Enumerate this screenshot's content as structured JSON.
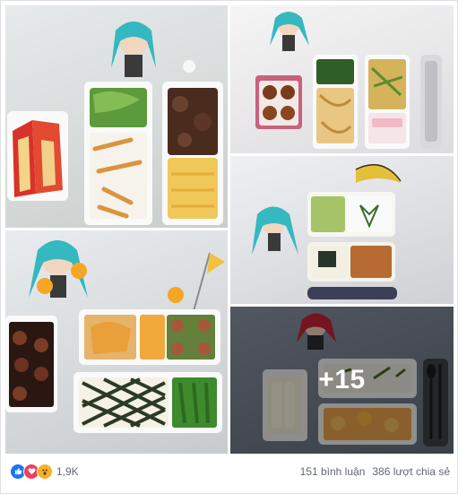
{
  "gallery": {
    "more_photos_label": "+15"
  },
  "reactions": {
    "count": "1,9K",
    "icons": [
      "like-icon",
      "love-icon",
      "wow-icon"
    ],
    "colors": {
      "like": "#1877f2",
      "love": "#f33e58",
      "wow": "#f7b125"
    }
  },
  "stats": {
    "comments": "151 bình luận",
    "shares": "386 lượt chia sẻ"
  }
}
